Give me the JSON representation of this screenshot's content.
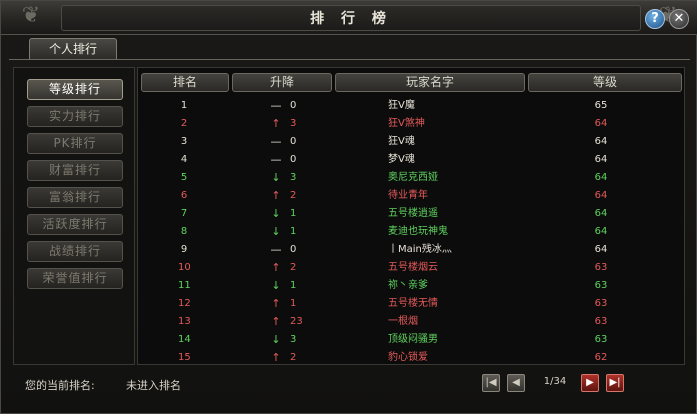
{
  "window": {
    "title": "排 行 榜"
  },
  "title_buttons": {
    "help": "?",
    "close": "✕"
  },
  "tabs": [
    {
      "label": "个人排行",
      "active": true
    }
  ],
  "sidebar": {
    "items": [
      {
        "label": "等级排行",
        "active": true
      },
      {
        "label": "实力排行",
        "active": false
      },
      {
        "label": "PK排行",
        "active": false
      },
      {
        "label": "财富排行",
        "active": false
      },
      {
        "label": "富翁排行",
        "active": false
      },
      {
        "label": "活跃度排行",
        "active": false
      },
      {
        "label": "战绩排行",
        "active": false
      },
      {
        "label": "荣誉值排行",
        "active": false
      }
    ]
  },
  "table": {
    "headers": {
      "rank": "排名",
      "change": "升降",
      "name": "玩家名字",
      "level": "等级"
    },
    "rows": [
      {
        "rank": "1",
        "arrow": "—",
        "delta": "0",
        "name": "狂V魔",
        "level": "65",
        "color": "white"
      },
      {
        "rank": "2",
        "arrow": "↑",
        "delta": "3",
        "name": "狂V煞神",
        "level": "64",
        "color": "red"
      },
      {
        "rank": "3",
        "arrow": "—",
        "delta": "0",
        "name": "狂V魂",
        "level": "64",
        "color": "white"
      },
      {
        "rank": "4",
        "arrow": "—",
        "delta": "0",
        "name": "梦V魂",
        "level": "64",
        "color": "white"
      },
      {
        "rank": "5",
        "arrow": "↓",
        "delta": "3",
        "name": "奥尼克西娅",
        "level": "64",
        "color": "green"
      },
      {
        "rank": "6",
        "arrow": "↑",
        "delta": "2",
        "name": "待业青年",
        "level": "64",
        "color": "red"
      },
      {
        "rank": "7",
        "arrow": "↓",
        "delta": "1",
        "name": "五号楼逍遥",
        "level": "64",
        "color": "green"
      },
      {
        "rank": "8",
        "arrow": "↓",
        "delta": "1",
        "name": "麦迪也玩神鬼",
        "level": "64",
        "color": "green"
      },
      {
        "rank": "9",
        "arrow": "—",
        "delta": "0",
        "name": "丨Main残冰灬",
        "level": "64",
        "color": "white"
      },
      {
        "rank": "10",
        "arrow": "↑",
        "delta": "2",
        "name": "五号楼烟云",
        "level": "63",
        "color": "red"
      },
      {
        "rank": "11",
        "arrow": "↓",
        "delta": "1",
        "name": "祢丶亲爹",
        "level": "63",
        "color": "green"
      },
      {
        "rank": "12",
        "arrow": "↑",
        "delta": "1",
        "name": "五号楼无情",
        "level": "63",
        "color": "red"
      },
      {
        "rank": "13",
        "arrow": "↑",
        "delta": "23",
        "name": "一根烟",
        "level": "63",
        "color": "red"
      },
      {
        "rank": "14",
        "arrow": "↓",
        "delta": "3",
        "name": "顶级闷骚男",
        "level": "63",
        "color": "green"
      },
      {
        "rank": "15",
        "arrow": "↑",
        "delta": "2",
        "name": "豹心锁爱",
        "level": "62",
        "color": "red"
      }
    ]
  },
  "footer": {
    "my_rank_label": "您的当前排名:",
    "my_rank_value": "未进入排名",
    "page": "1/34",
    "first_icon": "first-page-icon",
    "prev_icon": "previous-page-icon",
    "next_icon": "next-page-icon",
    "last_icon": "last-page-icon"
  }
}
